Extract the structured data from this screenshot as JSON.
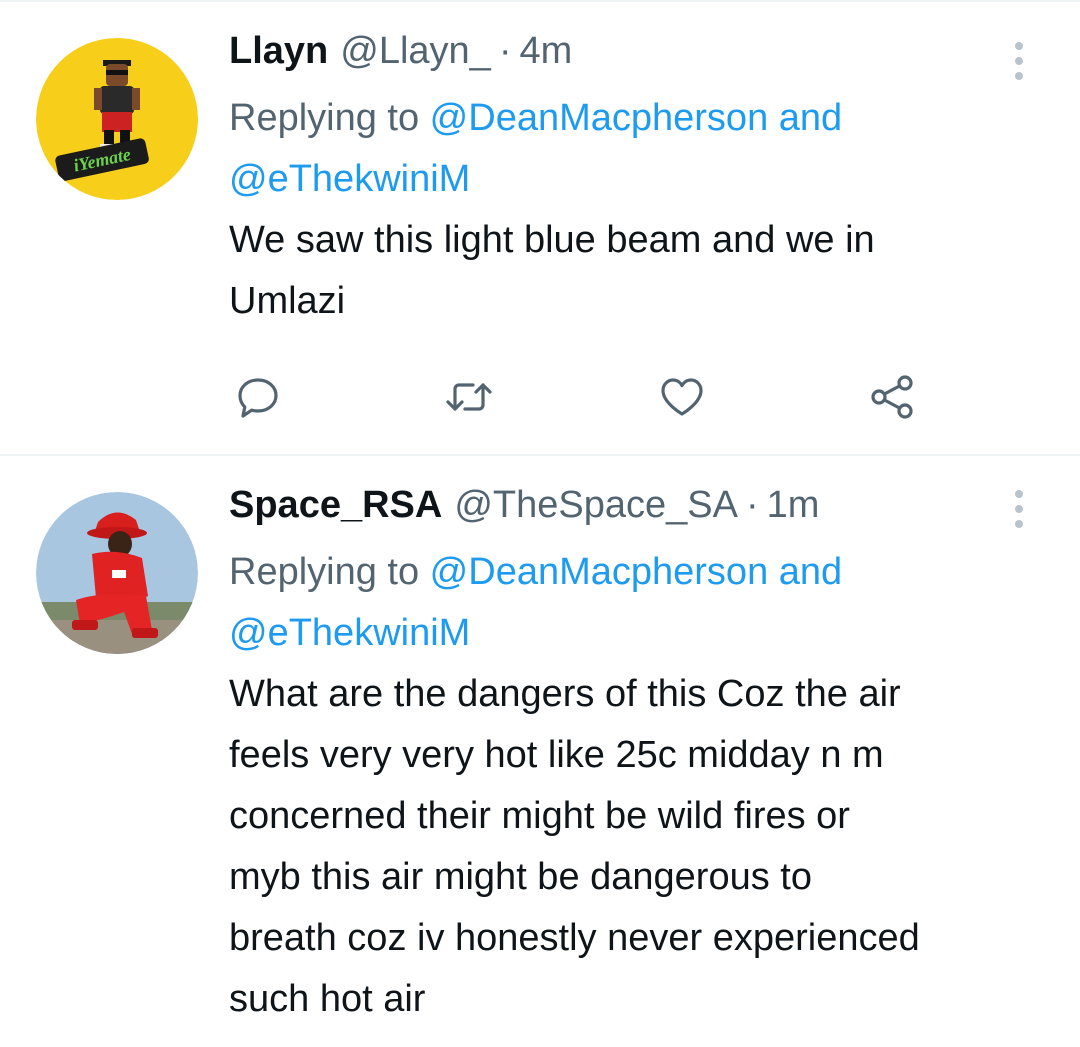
{
  "tweets": [
    {
      "name": "Llayn",
      "handle": "@Llayn_",
      "separator": "·",
      "time": "4m",
      "replying_prefix": "Replying to ",
      "mention_1": "@DeanMacpherson",
      "mention_joiner": " and",
      "mention_2": "@eThekwiniM",
      "text_lines": [
        "We saw this light blue beam and we in",
        "Umlazi"
      ],
      "avatar_logo_text": "iYemate",
      "avatar_bg": "#f7cf1b"
    },
    {
      "name": "Space_RSA",
      "handle": "@TheSpace_SA",
      "separator": "·",
      "time": "1m",
      "replying_prefix": "Replying to ",
      "mention_1": "@DeanMacpherson",
      "mention_joiner": " and",
      "mention_2": "@eThekwiniM",
      "text_lines": [
        "What are the dangers of this Coz the air",
        "feels very very hot like 25c midday n m",
        "concerned their might be wild fires or",
        "myb this air might be dangerous to",
        "breath coz iv honestly never experienced",
        "such hot air"
      ]
    }
  ],
  "actions": {
    "icons": [
      "reply-icon",
      "retweet-icon",
      "like-icon",
      "share-icon"
    ]
  },
  "colors": {
    "link": "#1d9bf0",
    "secondary_text": "#536471",
    "primary_text": "#0f1419",
    "divider": "#eff3f4"
  }
}
